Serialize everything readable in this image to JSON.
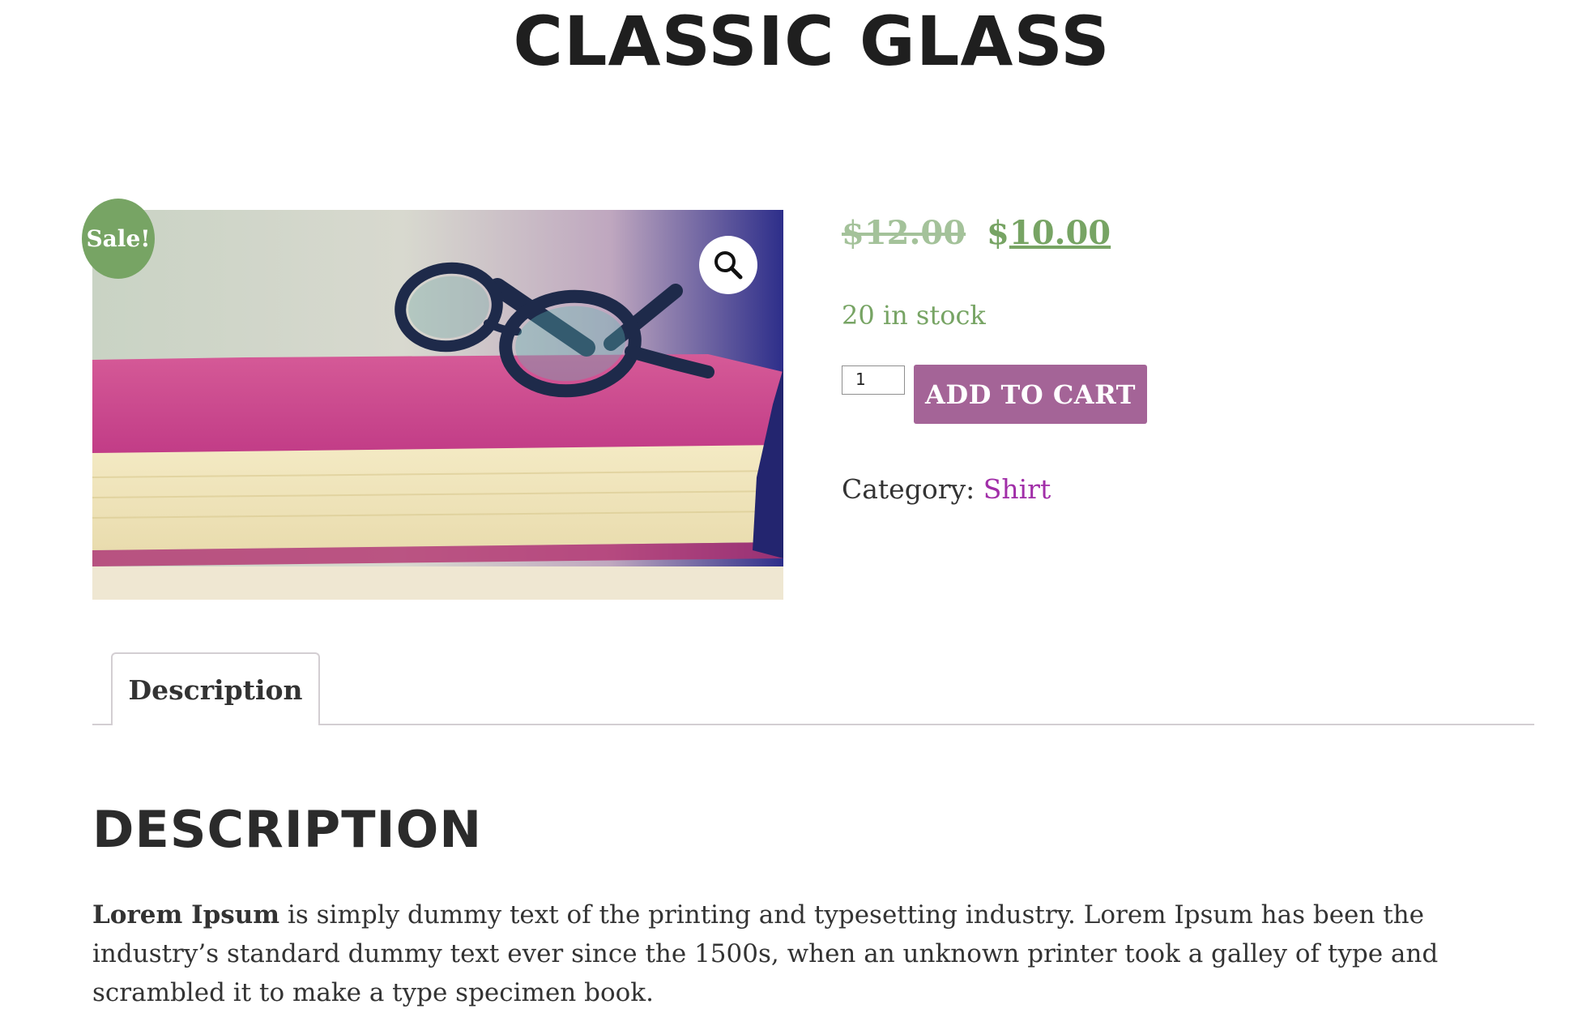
{
  "product": {
    "title": "CLASSIC GLASS",
    "sale_badge": "Sale!",
    "price": {
      "regular": "$12.00",
      "currency_symbol": "$",
      "sale_amount": "10.00"
    },
    "stock": "20 in stock",
    "quantity": "1",
    "add_to_cart_label": "ADD TO CART",
    "meta": {
      "category_label": "Category:",
      "category_value": "Shirt"
    },
    "image_subject": "eyeglasses resting on a pink hardcover book"
  },
  "tabs": [
    {
      "label": "Description",
      "active": true
    }
  ],
  "description": {
    "heading": "DESCRIPTION",
    "lead_bold": "Lorem Ipsum",
    "body": " is simply dummy text of the printing and typesetting industry. Lorem Ipsum has been the industry’s standard dummy text ever since the 1500s, when an unknown printer took a galley of type and scrambled it to make a type specimen book."
  },
  "icons": {
    "zoom": "magnifying-glass-icon"
  },
  "colors": {
    "sale_green": "#77a464",
    "button_purple": "#a46497",
    "link_purple": "#a12ea8",
    "tab_border": "#d3ced2"
  }
}
